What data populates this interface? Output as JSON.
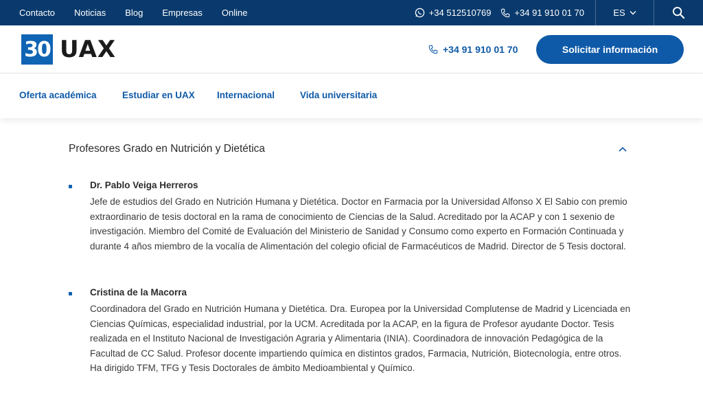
{
  "topbar": {
    "links": [
      "Contacto",
      "Noticias",
      "Blog",
      "Empresas",
      "Online"
    ],
    "whatsapp_phone": "+34 512510769",
    "phone": "+34 91 910 01 70",
    "language": "ES"
  },
  "header": {
    "logo_badge": "30",
    "logo_text": "UAX",
    "phone": "+34 91 910 01 70",
    "cta_label": "Solicitar información"
  },
  "mainnav": {
    "items": [
      "Oferta académica",
      "Estudiar en UAX",
      "Internacional",
      "Vida universitaria"
    ]
  },
  "content": {
    "section_title": "Profesores Grado en Nutrición y Dietética",
    "professors": [
      {
        "name": "Dr. Pablo Veiga Herreros",
        "description": "Jefe de estudios del Grado en Nutrición Humana y Dietética. Doctor en Farmacia por la Universidad Alfonso X El Sabio con premio extraordinario de tesis doctoral en la rama de conocimiento de Ciencias de la Salud. Acreditado por la ACAP y con 1 sexenio de investigación. Miembro del Comité de Evaluación del Ministerio de Sanidad y Consumo como experto en Formación Continuada y durante 4 años miembro de la vocalía de Alimentación del colegio oficial de Farmacéuticos de Madrid. Director de 5 Tesis doctoral."
      },
      {
        "name": "Cristina de la Macorra",
        "description": "Coordinadora del Grado en Nutrición Humana y Dietética. Dra. Europea por la Universidad Complutense de Madrid y Licenciada en Ciencias Químicas, especialidad industrial, por la UCM. Acreditada por la ACAP, en la figura de Profesor ayudante Doctor. Tesis realizada en el Instituto Nacional de Investigación Agraria y Alimentaria (INIA). Coordinadora de innovación Pedagógica de la Facultad de CC Salud. Profesor docente impartiendo química en distintos grados, Farmacia, Nutrición, Biotecnología, entre otros. Ha dirigido TFM, TFG y Tesis Doctorales de ámbito Medioambiental y Químico."
      }
    ]
  },
  "colors": {
    "topbar_bg": "#0a3a6d",
    "accent": "#0f5aa8",
    "logo_blue": "#1064b4"
  },
  "icons": [
    "whatsapp-icon",
    "phone-icon",
    "chevron-down-icon",
    "search-icon",
    "chevron-up-icon"
  ]
}
